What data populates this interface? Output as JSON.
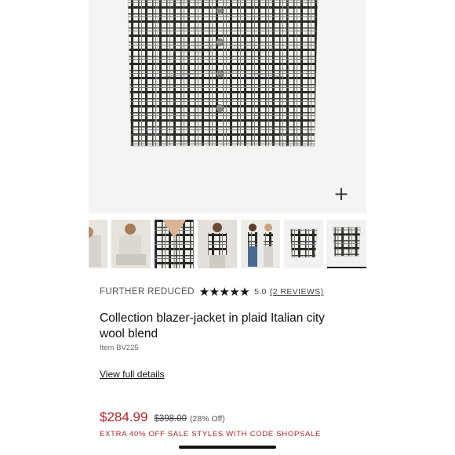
{
  "product": {
    "badge": "FURTHER REDUCED",
    "stars": [
      "★",
      "★",
      "★",
      "★",
      "★"
    ],
    "rating": "5.0",
    "reviews_link": "(2 REVIEWS)",
    "title": "Collection blazer-jacket in plaid Italian city wool blend",
    "item_number": "Item BV225",
    "details_link": "View full details",
    "sale_price": "$284.99",
    "original_price": "$398.00",
    "discount": "(28% Off)",
    "promo": "EXTRA 40% OFF SALE STYLES WITH CODE SHOPSALE"
  },
  "gallery": {
    "zoom_icon": "+",
    "thumbnails": [
      {
        "label": "model seated side view"
      },
      {
        "label": "model seated front view"
      },
      {
        "label": "jacket lapel close-up"
      },
      {
        "label": "model standing back view"
      },
      {
        "label": "two models full length"
      },
      {
        "label": "jacket flat lay front"
      },
      {
        "label": "jacket flat lay selected"
      }
    ],
    "active_index": 6
  },
  "colors": {
    "sale_red": "#b22222",
    "text_dark": "#111111",
    "plaid_light": "#f3f1ea",
    "plaid_dark": "#2a2a2a"
  }
}
